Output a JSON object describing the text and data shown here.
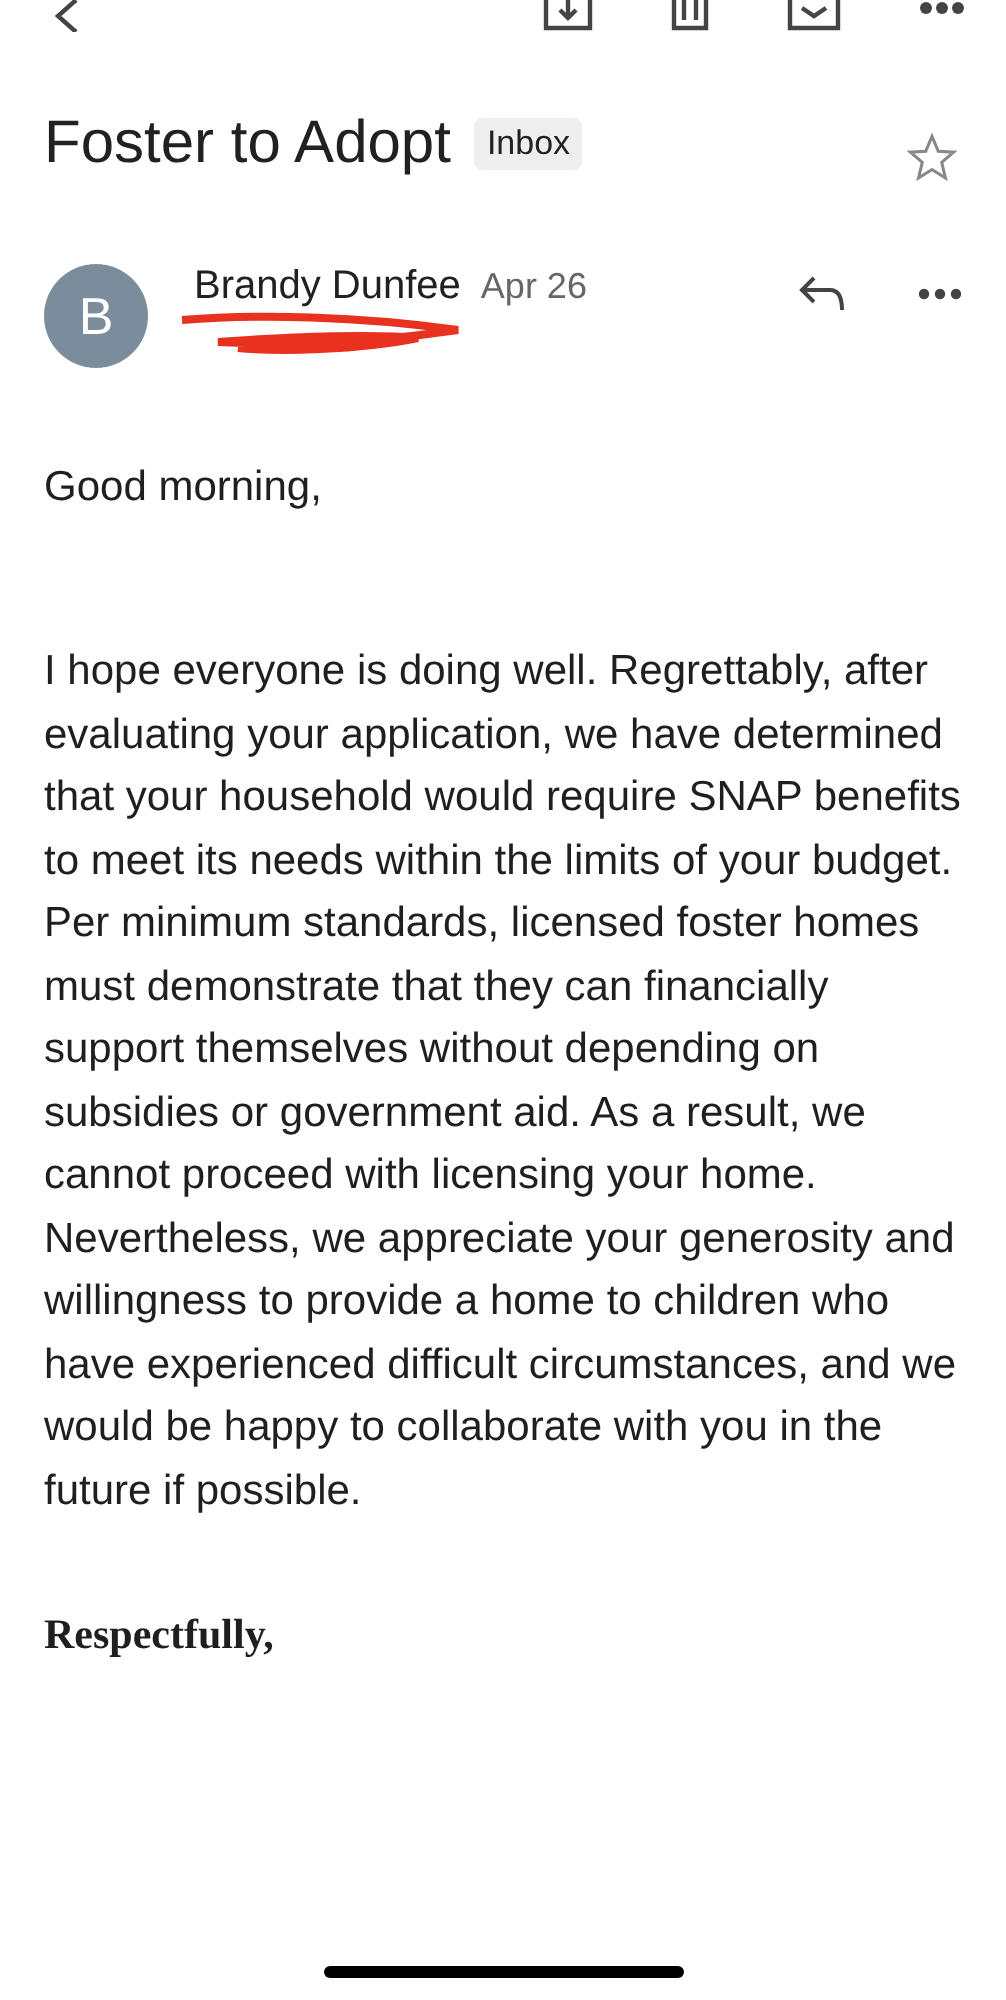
{
  "email": {
    "subject": "Foster to Adopt",
    "label": "Inbox",
    "starred": false,
    "sender": {
      "initial": "B",
      "name": "Brandy Dunfee",
      "date": "Apr 26"
    },
    "greeting": "Good morning,",
    "body": "I hope everyone is doing well. Regrettably, after evaluating your application, we have determined that your household would require SNAP benefits to meet its needs within the limits of your budget. Per minimum standards, licensed foster homes must demonstrate that they can financially support themselves without depending on subsidies or government aid. As a result, we cannot proceed with licensing your home. Nevertheless, we appreciate your generosity and willingness to provide a home to children who have experienced difficult circumstances, and we would be happy to collaborate with you in the future if possible.",
    "closing": "Respectfully,"
  }
}
